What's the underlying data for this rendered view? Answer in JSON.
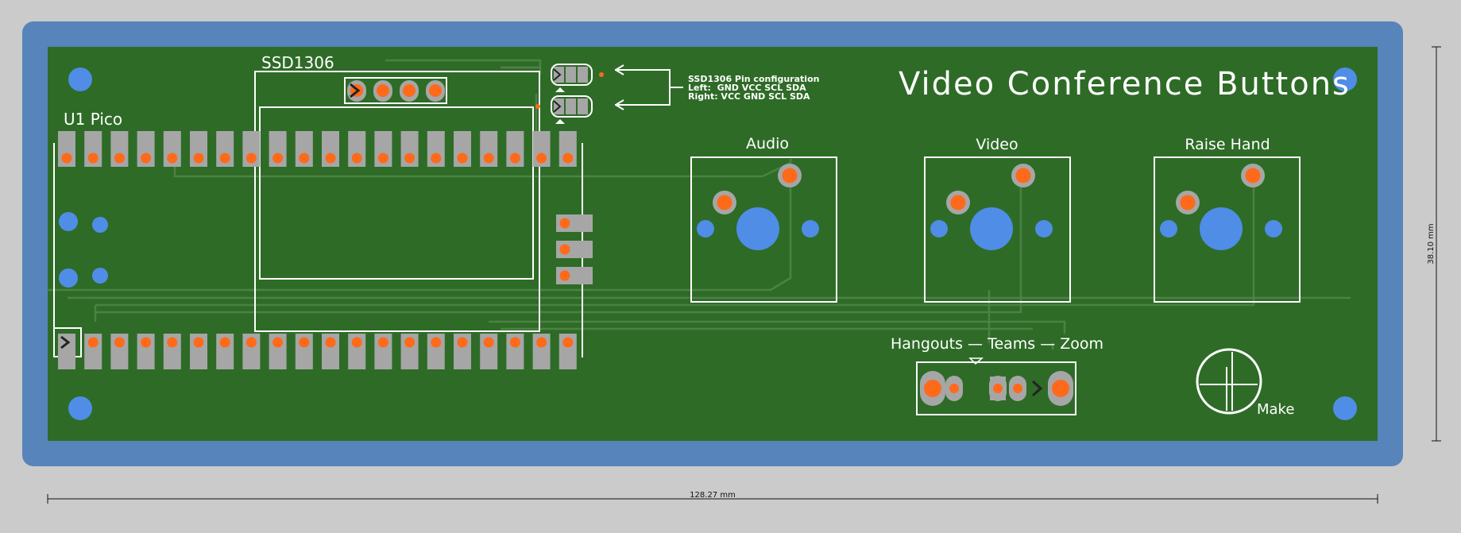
{
  "colors": {
    "background": "#cbcbcb",
    "board_edge": "#5784bb",
    "board": "#2e6b27",
    "trace": "#4c8244",
    "silkscreen": "#ffffff",
    "pad": "#a6a6a6",
    "drill": "#ff6a1a",
    "hole": "#4f8de6",
    "dimension": "#111111"
  },
  "labels": {
    "pico": "U1 Pico",
    "oled": "SSD1306",
    "title": "Video Conference Buttons",
    "pin_config_title": "SSD1306 Pin configuration",
    "pin_config_left": "Left:  GND VCC SCL SDA",
    "pin_config_right": "Right: VCC GND SCL SDA",
    "audio": "Audio",
    "video": "Video",
    "raise_hand": "Raise Hand",
    "mode": "Hangouts — Teams — Zoom",
    "make": "Make"
  },
  "dimensions": {
    "width": "128.27 mm",
    "height": "38.10 mm"
  },
  "icons": [
    "mounting-hole-icon",
    "pin-one-marker-icon",
    "arrow-left-icon",
    "make-logo-icon"
  ]
}
